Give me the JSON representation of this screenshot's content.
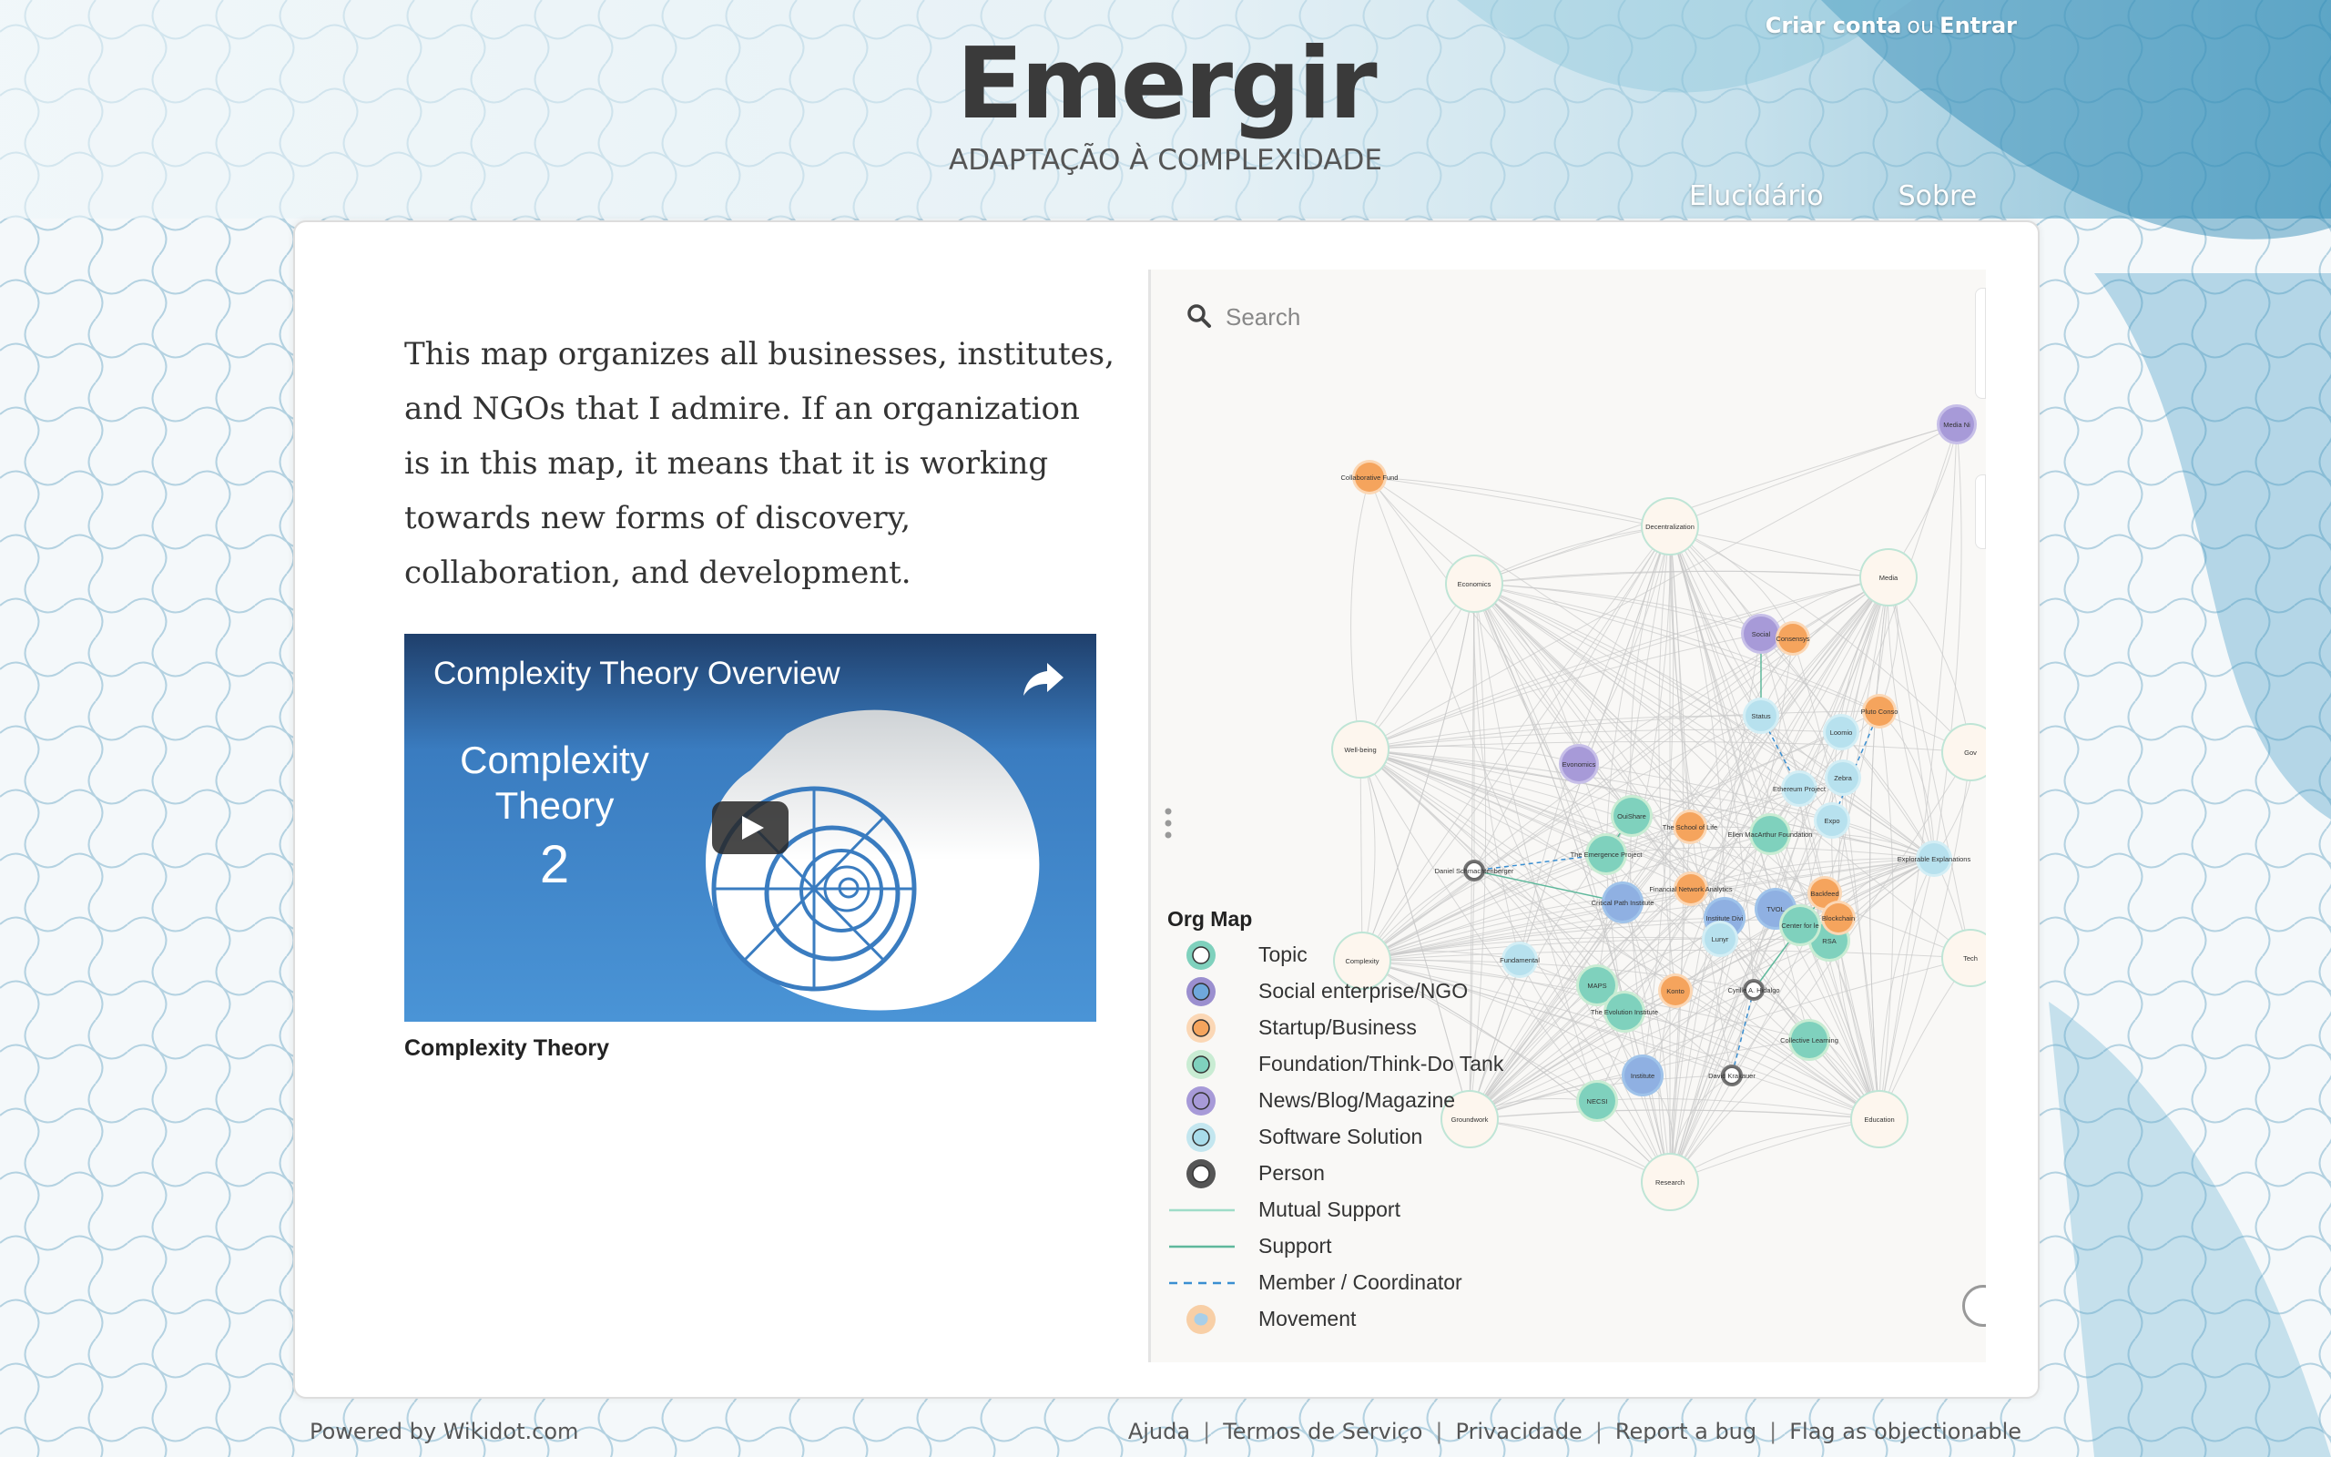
{
  "header": {
    "title": "Emergir",
    "subtitle": "ADAPTAÇÃO À COMPLEXIDADE",
    "create_account": "Criar conta",
    "or": "ou",
    "login": "Entrar",
    "nav": [
      {
        "label": "Elucidário"
      },
      {
        "label": "Sobre"
      }
    ]
  },
  "main": {
    "intro": "This map organizes all businesses, institutes, and NGOs that I admire. If an organization is in this map, it means that it is working towards new forms of discovery, collaboration, and development.",
    "video": {
      "title": "Complexity Theory Overview",
      "thumb_line1": "Complexity",
      "thumb_line2": "Theory",
      "thumb_number": "2",
      "caption": "Complexity Theory"
    }
  },
  "map": {
    "search_placeholder": "Search",
    "legend_title": "Org Map",
    "legend": [
      {
        "label": "Topic",
        "kind": "circle",
        "fill": "#ffffff",
        "ring": "#7fd1bd"
      },
      {
        "label": "Social enterprise/NGO",
        "kind": "circle",
        "fill": "#6fa8dc",
        "ring": "#9b8fcf"
      },
      {
        "label": "Startup/Business",
        "kind": "circle",
        "fill": "#f5a45d",
        "ring": "#fbd7b5"
      },
      {
        "label": "Foundation/Think-Do Tank",
        "kind": "circle",
        "fill": "#7fd1bd",
        "ring": "#c9ecd3"
      },
      {
        "label": "News/Blog/Magazine",
        "kind": "circle",
        "fill": "#a79ad8",
        "ring": "#a79ad8"
      },
      {
        "label": "Software Solution",
        "kind": "circle",
        "fill": "#a8dcea",
        "ring": "#c3e6ef"
      },
      {
        "label": "Person",
        "kind": "circle",
        "fill": "#ffffff",
        "ring": "#555555"
      },
      {
        "label": "Mutual Support",
        "kind": "line",
        "color": "#9fdcc8"
      },
      {
        "label": "Support",
        "kind": "line",
        "color": "#5fb89c"
      },
      {
        "label": "Member / Coordinator",
        "kind": "dash",
        "color": "#3b8fd1"
      },
      {
        "label": "Movement",
        "kind": "blob",
        "fill": "#f8cfa6"
      }
    ],
    "nodes": [
      {
        "label": "Collaborative Fund",
        "type": "startup"
      },
      {
        "label": "Decentralization",
        "type": "topic"
      },
      {
        "label": "Economics",
        "type": "topic"
      },
      {
        "label": "Media",
        "type": "topic"
      },
      {
        "label": "Social",
        "type": "news"
      },
      {
        "label": "Consensys",
        "type": "startup"
      },
      {
        "label": "Status",
        "type": "software"
      },
      {
        "label": "Well-being",
        "type": "topic"
      },
      {
        "label": "Evonomics",
        "type": "news"
      },
      {
        "label": "OuiShare",
        "type": "foundation"
      },
      {
        "label": "The School of Life",
        "type": "startup"
      },
      {
        "label": "Ellen MacArthur Foundation",
        "type": "foundation"
      },
      {
        "label": "The Emergence Project",
        "type": "foundation"
      },
      {
        "label": "Daniel Schmachtenberger",
        "type": "person"
      },
      {
        "label": "Critical Path Institute",
        "type": "ngo"
      },
      {
        "label": "Financial Network Analytics",
        "type": "startup"
      },
      {
        "label": "TVOL",
        "type": "ngo"
      },
      {
        "label": "Institute Divi",
        "type": "ngo"
      },
      {
        "label": "Lunyr",
        "type": "software"
      },
      {
        "label": "RSA",
        "type": "foundation"
      },
      {
        "label": "Complexity",
        "type": "topic"
      },
      {
        "label": "Fundamental",
        "type": "software"
      },
      {
        "label": "MAPS",
        "type": "foundation"
      },
      {
        "label": "The Evolution Institute",
        "type": "foundation"
      },
      {
        "label": "Konto",
        "type": "startup"
      },
      {
        "label": "Collective Learning",
        "type": "foundation"
      },
      {
        "label": "Institute",
        "type": "ngo"
      },
      {
        "label": "NECSI",
        "type": "foundation"
      },
      {
        "label": "Groundwork",
        "type": "topic"
      },
      {
        "label": "Research",
        "type": "topic"
      },
      {
        "label": "Education",
        "type": "topic"
      },
      {
        "label": "Explorable Explanations",
        "type": "software"
      },
      {
        "label": "Media Ni",
        "type": "news"
      },
      {
        "label": "Ethereum Project",
        "type": "software"
      },
      {
        "label": "Loomio",
        "type": "software"
      },
      {
        "label": "Pluto Conso",
        "type": "startup"
      },
      {
        "label": "Expo",
        "type": "software"
      },
      {
        "label": "Zebra",
        "type": "software"
      },
      {
        "label": "Backfeed",
        "type": "startup"
      },
      {
        "label": "Blockchain",
        "type": "startup"
      },
      {
        "label": "Center for le",
        "type": "foundation"
      },
      {
        "label": "Cyrille A. Hidalgo",
        "type": "person"
      },
      {
        "label": "David Krakauer",
        "type": "person"
      },
      {
        "label": "Tech",
        "type": "topic"
      },
      {
        "label": "Gov",
        "type": "topic"
      }
    ]
  },
  "footer": {
    "powered_by": "Powered by Wikidot.com",
    "links": [
      {
        "label": "Ajuda"
      },
      {
        "label": "Termos de Serviço"
      },
      {
        "label": "Privacidade"
      },
      {
        "label": "Report a bug"
      },
      {
        "label": "Flag as objectionable"
      }
    ]
  }
}
